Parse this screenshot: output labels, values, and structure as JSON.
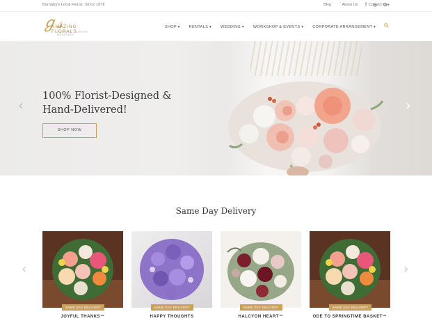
{
  "topbar": {
    "tagline": "Burnaby's Local Florist. Since 1978",
    "links": [
      "Blog",
      "About Us",
      "Contact Us"
    ],
    "social_icons": [
      "facebook-icon",
      "instagram-icon",
      "google-plus-icon"
    ],
    "social_glyphs": [
      "f",
      "◎",
      "G+"
    ]
  },
  "logo": {
    "name": "AMAZING FLORALS",
    "sub": "FLOWERS · EVENTS · WEDDINGS"
  },
  "nav": {
    "items": [
      "SHOP ▾",
      "RENTALS ▾",
      "WEDDING ▾",
      "WORKSHOP & EVENTS ▾",
      "CORPORATE ARRANGEMENT ▾"
    ],
    "search_icon": "search-icon"
  },
  "hero": {
    "title_line1": "100% Florist-Designed &",
    "title_line2": "Hand-Delivered!",
    "button": "SHOP NOW",
    "prev": "‹",
    "next": "›"
  },
  "section": {
    "title": "Same Day Delivery"
  },
  "products": [
    {
      "name": "JOYFUL THANKS™",
      "badge": "SAME DAY DELIVERY"
    },
    {
      "name": "HAPPY THOUGHTS",
      "badge": "SAME DAY DELIVERY"
    },
    {
      "name": "HALCYON HEART™",
      "badge": "SAME DAY DELIVERY"
    },
    {
      "name": "ODE TO SPRINGTIME BASKET™",
      "badge": "SAME DAY DELIVERY"
    }
  ],
  "carousel": {
    "prev": "‹",
    "next": "›"
  },
  "colors": {
    "accent": "#c9a25a",
    "text": "#333333"
  }
}
